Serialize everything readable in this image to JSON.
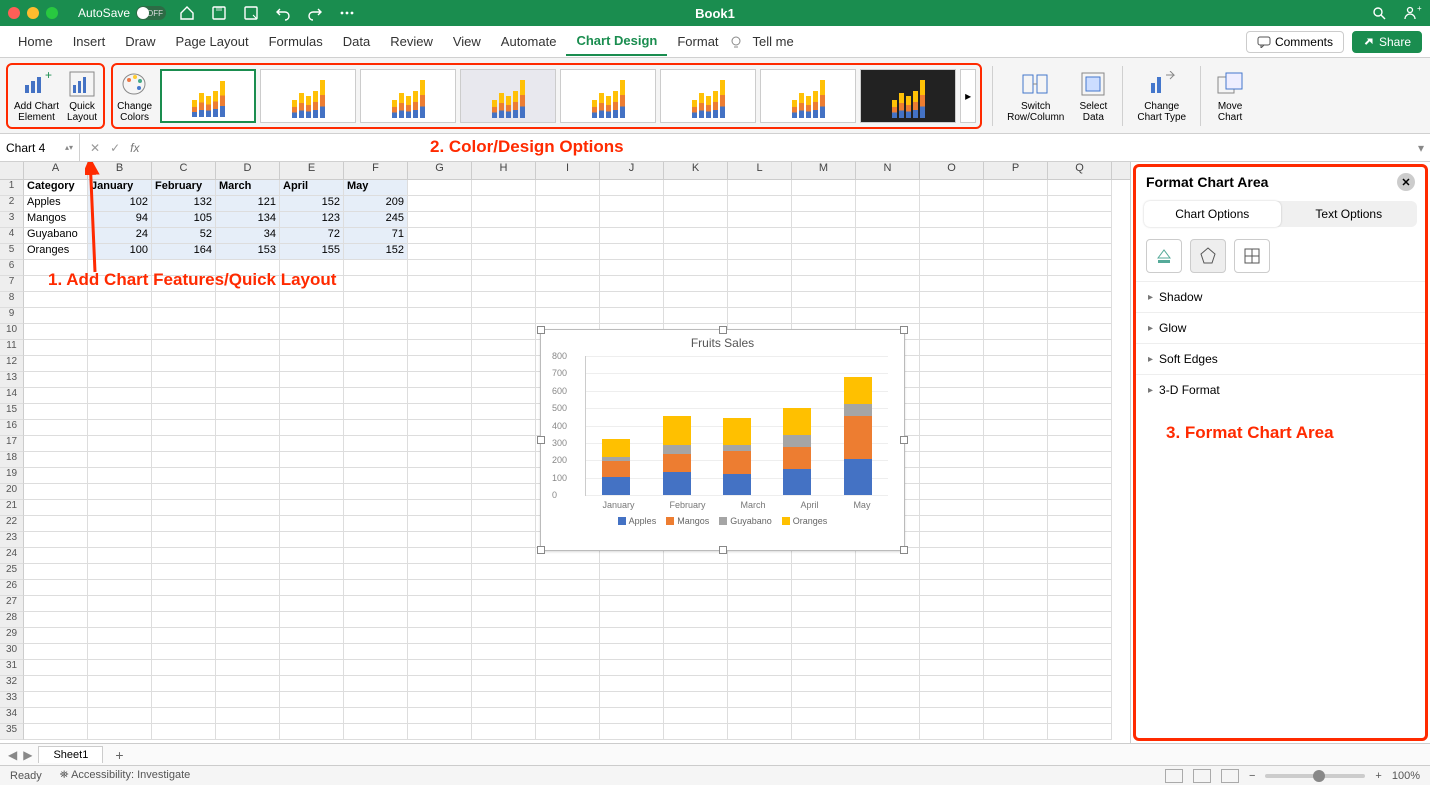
{
  "window": {
    "autosave_label": "AutoSave",
    "autosave_state": "OFF",
    "title": "Book1"
  },
  "menu": {
    "tabs": [
      "Home",
      "Insert",
      "Draw",
      "Page Layout",
      "Formulas",
      "Data",
      "Review",
      "View",
      "Automate",
      "Chart Design",
      "Format"
    ],
    "active": "Chart Design",
    "tell_me": "Tell me",
    "comments": "Comments",
    "share": "Share"
  },
  "ribbon": {
    "add_chart_element": "Add Chart\nElement",
    "quick_layout": "Quick\nLayout",
    "change_colors": "Change\nColors",
    "switch_rc": "Switch\nRow/Column",
    "select_data": "Select\nData",
    "change_type": "Change\nChart Type",
    "move_chart": "Move\nChart"
  },
  "annotations": {
    "a1": "1. Add Chart Features/Quick Layout",
    "a2": "2. Color/Design Options",
    "a3": "3. Format Chart Area"
  },
  "namebox": "Chart 4",
  "colheaders": [
    "A",
    "B",
    "C",
    "D",
    "E",
    "F",
    "G",
    "H",
    "I",
    "J",
    "K",
    "L",
    "M",
    "N",
    "O",
    "P",
    "Q"
  ],
  "table": {
    "headers": [
      "Category",
      "January",
      "February",
      "March",
      "April",
      "May"
    ],
    "rows": [
      {
        "cat": "Apples",
        "vals": [
          102,
          132,
          121,
          152,
          209
        ]
      },
      {
        "cat": "Mangos",
        "vals": [
          94,
          105,
          134,
          123,
          245
        ]
      },
      {
        "cat": "Guyabano",
        "vals": [
          24,
          52,
          34,
          72,
          71
        ]
      },
      {
        "cat": "Oranges",
        "vals": [
          100,
          164,
          153,
          155,
          152
        ]
      }
    ]
  },
  "chart_data": {
    "type": "bar",
    "title": "Fruits Sales",
    "stacked": true,
    "categories": [
      "January",
      "February",
      "March",
      "April",
      "May"
    ],
    "series": [
      {
        "name": "Apples",
        "values": [
          102,
          132,
          121,
          152,
          209
        ],
        "color": "#4472c4"
      },
      {
        "name": "Mangos",
        "values": [
          94,
          105,
          134,
          123,
          245
        ],
        "color": "#ed7d31"
      },
      {
        "name": "Guyabano",
        "values": [
          24,
          52,
          34,
          72,
          71
        ],
        "color": "#a5a5a5"
      },
      {
        "name": "Oranges",
        "values": [
          100,
          164,
          153,
          155,
          152
        ],
        "color": "#ffc000"
      }
    ],
    "ylim": [
      0,
      800
    ],
    "yticks": [
      0,
      100,
      200,
      300,
      400,
      500,
      600,
      700,
      800
    ],
    "xlabel": "",
    "ylabel": ""
  },
  "format_pane": {
    "title": "Format Chart Area",
    "tab_chart": "Chart Options",
    "tab_text": "Text Options",
    "items": [
      "Shadow",
      "Glow",
      "Soft Edges",
      "3-D Format"
    ]
  },
  "sheet_tab": "Sheet1",
  "status": {
    "ready": "Ready",
    "access": "Accessibility: Investigate",
    "zoom": "100%"
  }
}
